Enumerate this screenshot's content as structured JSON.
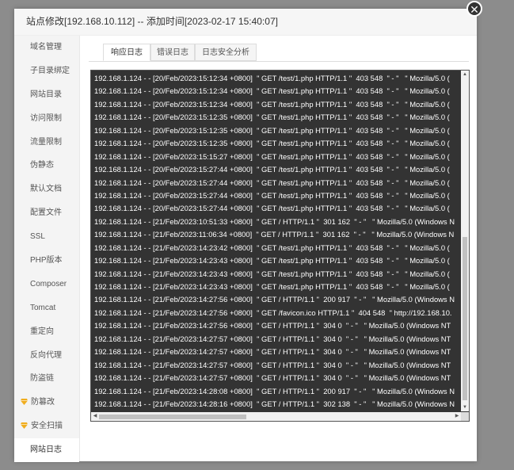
{
  "dialog": {
    "title": "站点修改[192.168.10.112] -- 添加时间[2023-02-17 15:40:07]",
    "close_glyph": "✕"
  },
  "sidebar": {
    "items": [
      {
        "label": "域名管理"
      },
      {
        "label": "子目录绑定"
      },
      {
        "label": "网站目录"
      },
      {
        "label": "访问限制"
      },
      {
        "label": "流量限制"
      },
      {
        "label": "伪静态"
      },
      {
        "label": "默认文档"
      },
      {
        "label": "配置文件"
      },
      {
        "label": "SSL"
      },
      {
        "label": "PHP版本"
      },
      {
        "label": "Composer"
      },
      {
        "label": "Tomcat"
      },
      {
        "label": "重定向"
      },
      {
        "label": "反向代理"
      },
      {
        "label": "防盗链"
      },
      {
        "label": "防篡改",
        "icon": "gem-icon"
      },
      {
        "label": "安全扫描",
        "icon": "gem-icon"
      },
      {
        "label": "网站日志"
      }
    ],
    "active_index": 17,
    "icon_color": "#f0ad1e"
  },
  "tabs": [
    {
      "label": "响应日志"
    },
    {
      "label": "错误日志"
    },
    {
      "label": "日志安全分析"
    }
  ],
  "log": {
    "lines": [
      "192.168.1.124 - - [20/Feb/2023:15:12:34 +0800]  \" GET /test/1.php HTTP/1.1 \"  403 548  \" - \"   \" Mozilla/5.0 (",
      "192.168.1.124 - - [20/Feb/2023:15:12:34 +0800]  \" GET /test/1.php HTTP/1.1 \"  403 548  \" - \"   \" Mozilla/5.0 (",
      "192.168.1.124 - - [20/Feb/2023:15:12:34 +0800]  \" GET /test/1.php HTTP/1.1 \"  403 548  \" - \"   \" Mozilla/5.0 (",
      "192.168.1.124 - - [20/Feb/2023:15:12:35 +0800]  \" GET /test/1.php HTTP/1.1 \"  403 548  \" - \"   \" Mozilla/5.0 (",
      "192.168.1.124 - - [20/Feb/2023:15:12:35 +0800]  \" GET /test/1.php HTTP/1.1 \"  403 548  \" - \"   \" Mozilla/5.0 (",
      "192.168.1.124 - - [20/Feb/2023:15:12:35 +0800]  \" GET /test/1.php HTTP/1.1 \"  403 548  \" - \"   \" Mozilla/5.0 (",
      "192.168.1.124 - - [20/Feb/2023:15:15:27 +0800]  \" GET /test/1.php HTTP/1.1 \"  403 548  \" - \"   \" Mozilla/5.0 (",
      "192.168.1.124 - - [20/Feb/2023:15:27:44 +0800]  \" GET /test/1.php HTTP/1.1 \"  403 548  \" - \"   \" Mozilla/5.0 (",
      "192.168.1.124 - - [20/Feb/2023:15:27:44 +0800]  \" GET /test/1.php HTTP/1.1 \"  403 548  \" - \"   \" Mozilla/5.0 (",
      "192.168.1.124 - - [20/Feb/2023:15:27:44 +0800]  \" GET /test/1.php HTTP/1.1 \"  403 548  \" - \"   \" Mozilla/5.0 (",
      "192.168.1.124 - - [20/Feb/2023:15:27:44 +0800]  \" GET /test/1.php HTTP/1.1 \"  403 548  \" - \"   \" Mozilla/5.0 (",
      "192.168.1.124 - - [21/Feb/2023:10:51:33 +0800]  \" GET / HTTP/1.1 \"  301 162  \" - \"   \" Mozilla/5.0 (Windows N",
      "192.168.1.124 - - [21/Feb/2023:11:06:34 +0800]  \" GET / HTTP/1.1 \"  301 162  \" - \"   \" Mozilla/5.0 (Windows N",
      "192.168.1.124 - - [21/Feb/2023:14:23:42 +0800]  \" GET /test/1.php HTTP/1.1 \"  403 548  \" - \"   \" Mozilla/5.0 (",
      "192.168.1.124 - - [21/Feb/2023:14:23:43 +0800]  \" GET /test/1.php HTTP/1.1 \"  403 548  \" - \"   \" Mozilla/5.0 (",
      "192.168.1.124 - - [21/Feb/2023:14:23:43 +0800]  \" GET /test/1.php HTTP/1.1 \"  403 548  \" - \"   \" Mozilla/5.0 (",
      "192.168.1.124 - - [21/Feb/2023:14:23:43 +0800]  \" GET /test/1.php HTTP/1.1 \"  403 548  \" - \"   \" Mozilla/5.0 (",
      "192.168.1.124 - - [21/Feb/2023:14:27:56 +0800]  \" GET / HTTP/1.1 \"  200 917  \" - \"   \" Mozilla/5.0 (Windows N",
      "192.168.1.124 - - [21/Feb/2023:14:27:56 +0800]  \" GET /favicon.ico HTTP/1.1 \"  404 548  \" http://192.168.10.",
      "192.168.1.124 - - [21/Feb/2023:14:27:56 +0800]  \" GET / HTTP/1.1 \"  304 0  \" - \"   \" Mozilla/5.0 (Windows NT",
      "192.168.1.124 - - [21/Feb/2023:14:27:57 +0800]  \" GET / HTTP/1.1 \"  304 0  \" - \"   \" Mozilla/5.0 (Windows NT",
      "192.168.1.124 - - [21/Feb/2023:14:27:57 +0800]  \" GET / HTTP/1.1 \"  304 0  \" - \"   \" Mozilla/5.0 (Windows NT",
      "192.168.1.124 - - [21/Feb/2023:14:27:57 +0800]  \" GET / HTTP/1.1 \"  304 0  \" - \"   \" Mozilla/5.0 (Windows NT",
      "192.168.1.124 - - [21/Feb/2023:14:27:57 +0800]  \" GET / HTTP/1.1 \"  304 0  \" - \"   \" Mozilla/5.0 (Windows NT",
      "192.168.1.124 - - [21/Feb/2023:14:28:08 +0800]  \" GET / HTTP/1.1 \"  200 917  \" - \"   \" Mozilla/5.0 (Windows N",
      "192.168.1.124 - - [21/Feb/2023:14:28:16 +0800]  \" GET / HTTP/1.1 \"  302 138  \" - \"   \" Mozilla/5.0 (Windows N"
    ]
  }
}
